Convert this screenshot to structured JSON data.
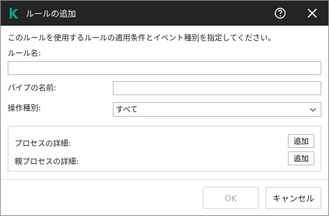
{
  "window": {
    "title": "ルールの追加",
    "icons": {
      "logo": "kaspersky-k-logo",
      "help": "help-icon",
      "close": "close-icon"
    }
  },
  "form": {
    "description": "このルールを使用するルールの適用条件とイベント種別を指定してください。",
    "rule_name_label": "ルール名:",
    "rule_name_value": "",
    "pipe_name_label": "パイプの名前:",
    "pipe_name_value": "",
    "operation_type_label": "操作種別:",
    "operation_type_value": "すべて"
  },
  "details": {
    "process_label": "プロセスの詳細:",
    "process_add": "追加",
    "parent_process_label": "親プロセスの詳細:",
    "parent_process_add": "追加"
  },
  "footer": {
    "ok_label": "OK",
    "cancel_label": "キャンセル"
  },
  "colors": {
    "titlebar": "#222426",
    "accent": "#00a88e",
    "disabled_text": "#a8a8a8"
  }
}
